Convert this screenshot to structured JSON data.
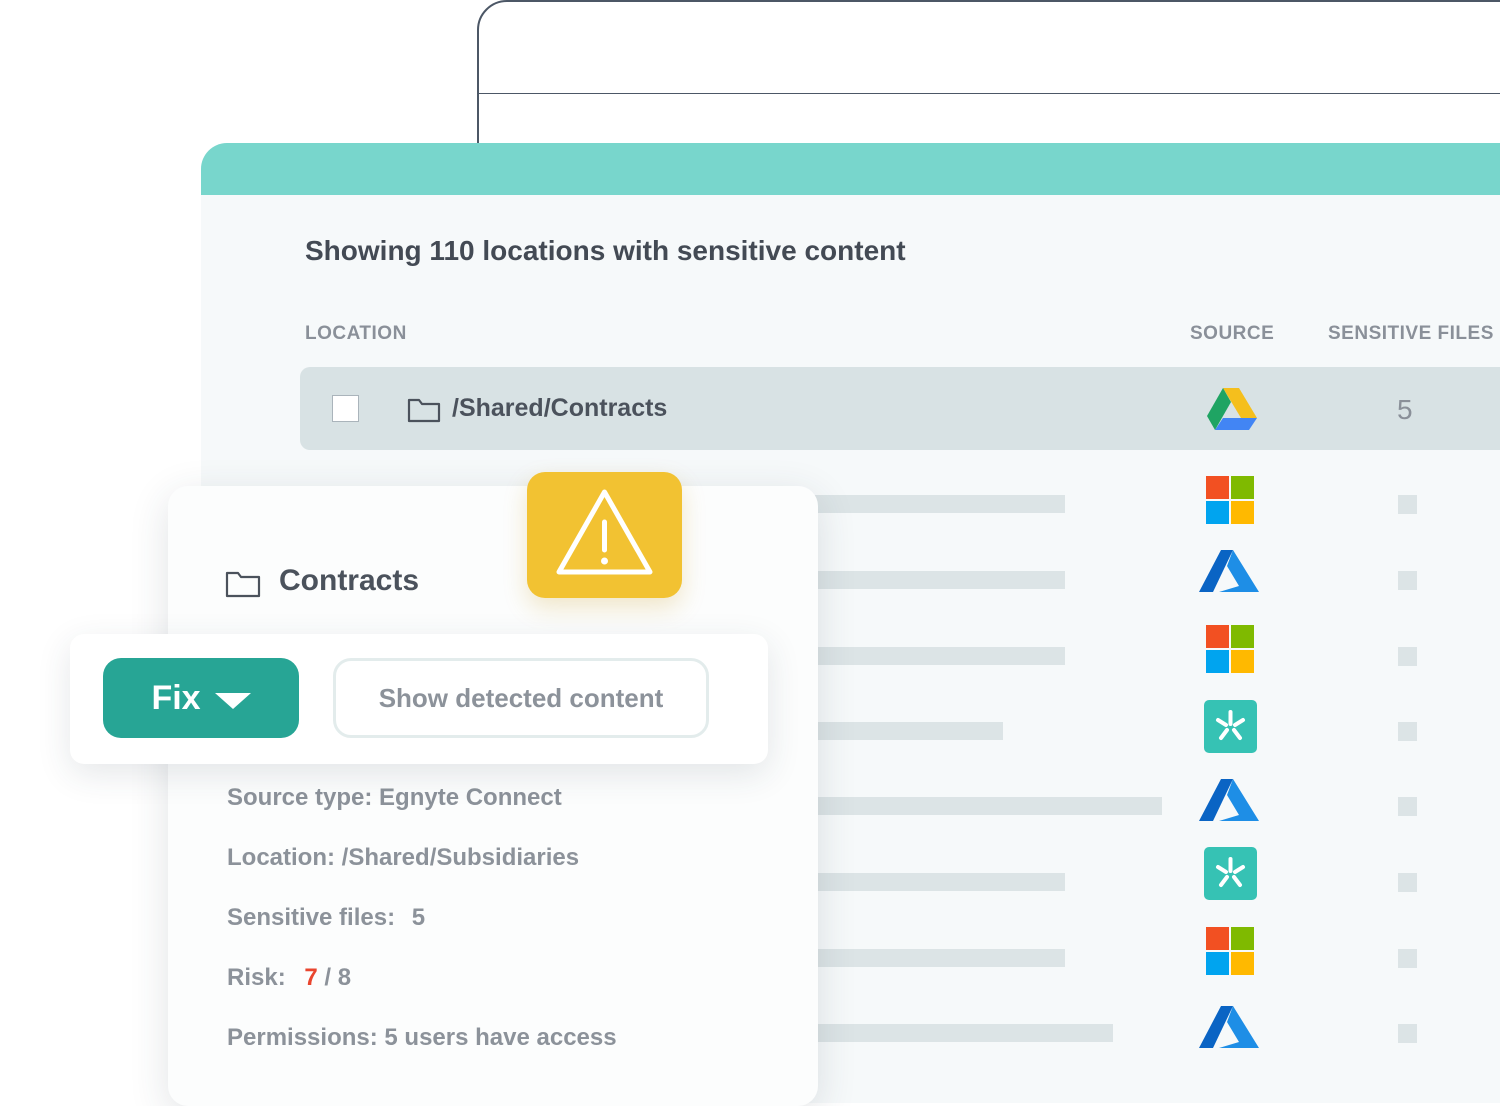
{
  "panel": {
    "title": "Showing 110 locations with sensitive content",
    "columns": {
      "location": "LOCATION",
      "source": "SOURCE",
      "sensitive_files": "SENSITIVE FILES"
    },
    "selected_row": {
      "path": "/Shared/Contracts",
      "source_icon": "google-drive-icon",
      "count": "5"
    },
    "row_sources": [
      "microsoft-icon",
      "azure-icon",
      "microsoft-icon",
      "egnyte-icon",
      "azure-icon",
      "egnyte-icon",
      "microsoft-icon",
      "azure-icon"
    ]
  },
  "card": {
    "title": "Contracts",
    "source_type": "Source type: Egnyte Connect",
    "location": "Location: /Shared/Subsidiaries",
    "sensitive_files_label": "Sensitive files:",
    "sensitive_files_value": "5",
    "risk_label": "Risk:",
    "risk_value": "7",
    "risk_max": "/ 8",
    "permissions": "Permissions: 5 users have access"
  },
  "actions": {
    "fix_label": "Fix",
    "show_label": "Show detected content"
  },
  "colors": {
    "header": "#78d6cc",
    "fix_button": "#27a595",
    "warning": "#f2c232",
    "risk_high": "#e9452e",
    "egnyte": "#36c2b4"
  }
}
